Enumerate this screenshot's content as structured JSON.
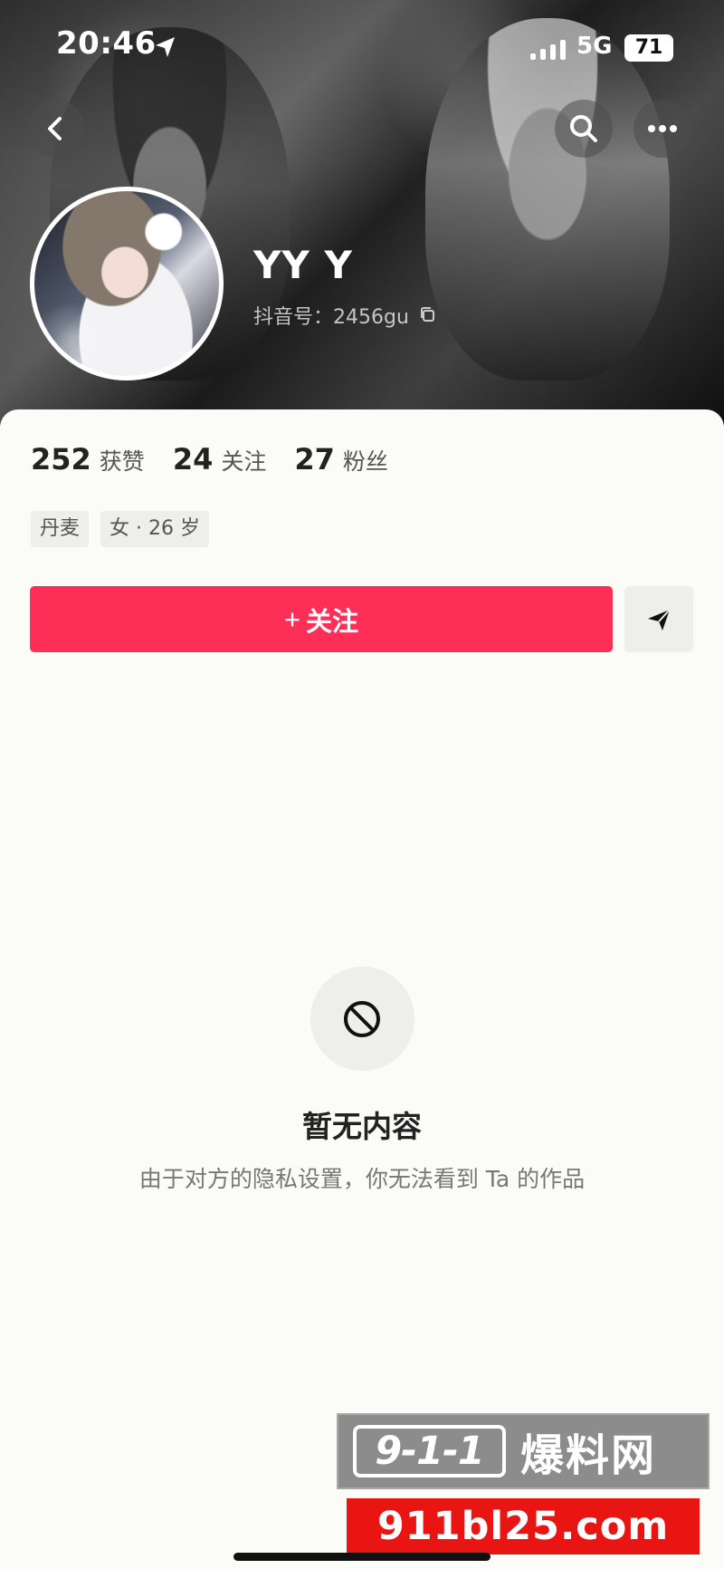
{
  "status_bar": {
    "time": "20:46",
    "network": "5G",
    "battery": "71",
    "icons": [
      "location-icon",
      "signal-icon"
    ]
  },
  "header": {
    "icons": [
      "back-icon",
      "search-icon",
      "more-icon"
    ]
  },
  "profile": {
    "name": "YY Y",
    "douyin_id": "抖音号：2456gu",
    "avatar_description": "avatar image"
  },
  "stats": [
    {
      "number": "252",
      "label": "获赞"
    },
    {
      "number": "24",
      "label": "关注"
    },
    {
      "number": "27",
      "label": "粉丝"
    }
  ],
  "tags": [
    "丹麦",
    "女 · 26 岁"
  ],
  "actions": {
    "follow_plus": "+",
    "follow_label": "关注",
    "send_icon": "send-icon"
  },
  "empty_state": {
    "icon": "blocked-icon",
    "title": "暂无内容",
    "message": "由于对方的隐私设置，你无法看到 Ta 的作品"
  },
  "watermark": {
    "code": "9-1-1",
    "name": "爆料网",
    "url": "911bl25.com"
  },
  "colors": {
    "follow_button": "#fe2f57",
    "watermark_red": "#e81513",
    "page_background": "#fbfbf8"
  }
}
